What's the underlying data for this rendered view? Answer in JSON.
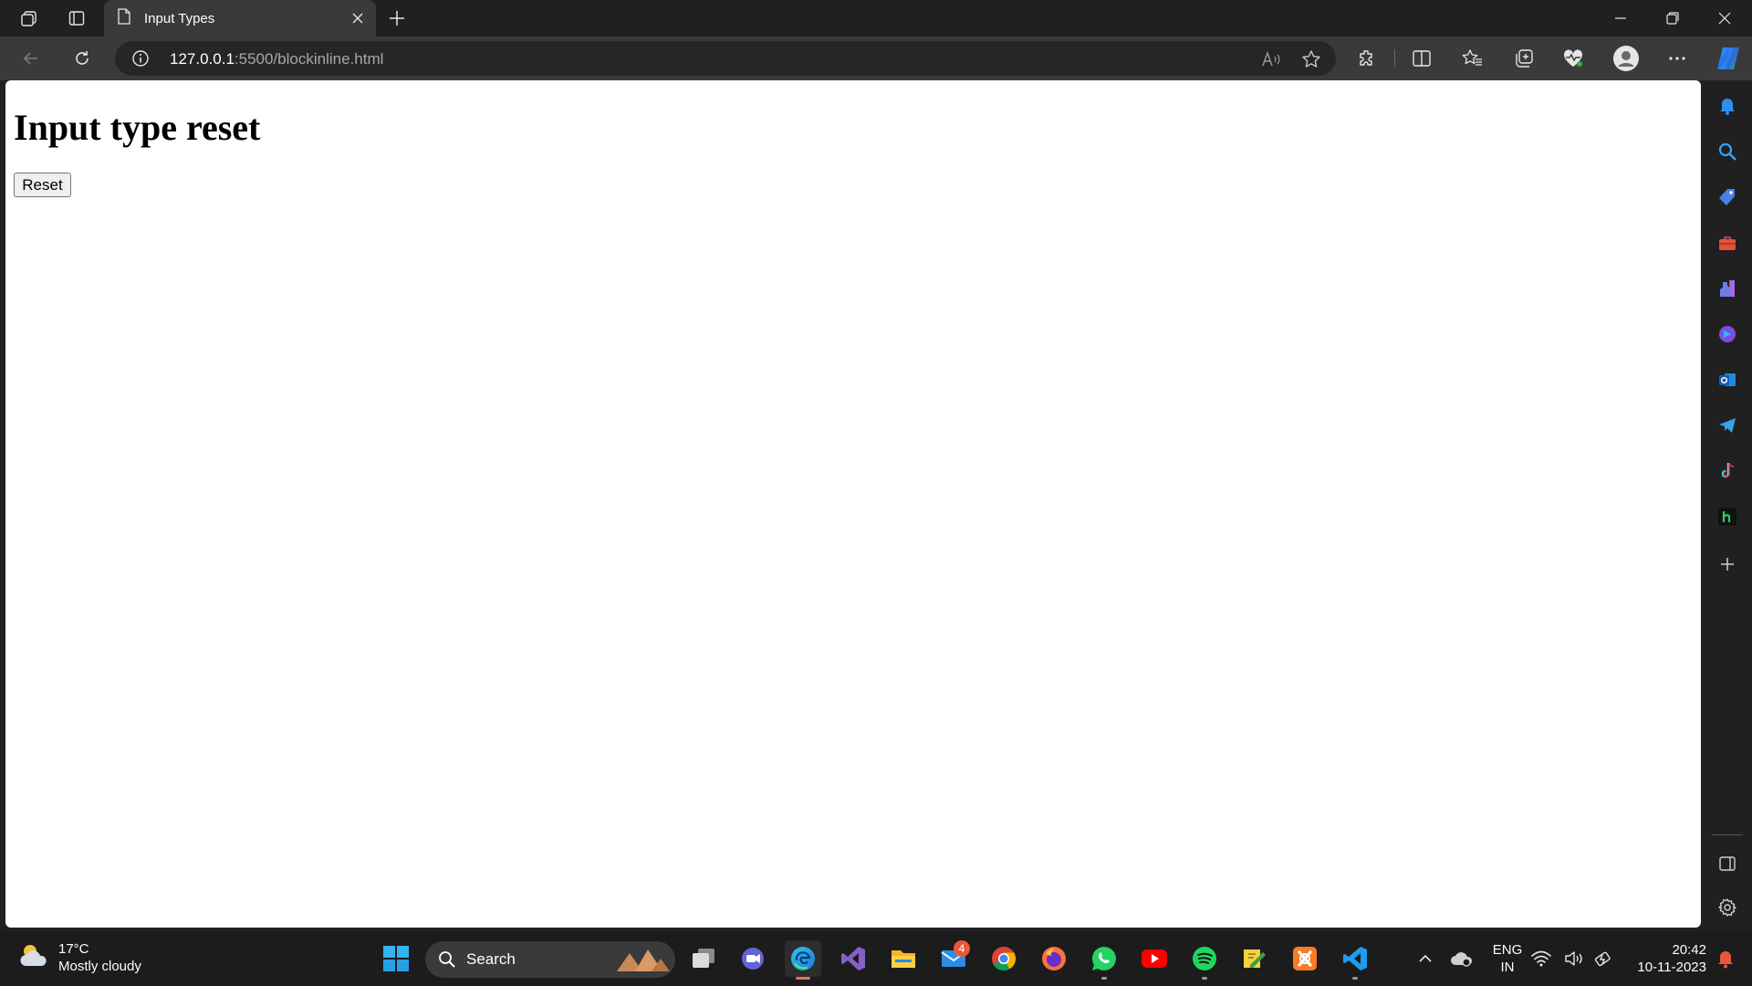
{
  "browser": {
    "tab_title": "Input Types",
    "url_host": "127.0.0.1",
    "url_path": ":5500/blockinline.html"
  },
  "page": {
    "heading": "Input type reset",
    "reset_button_label": "Reset"
  },
  "taskbar": {
    "weather_temp": "17°C",
    "weather_desc": "Mostly cloudy",
    "search_label": "Search",
    "mail_badge": "4",
    "lang_line1": "ENG",
    "lang_line2": "IN",
    "time": "20:42",
    "date": "10-11-2023"
  },
  "colors": {
    "accent_red": "#e8593b",
    "page_bg": "#ffffff",
    "chrome_dark": "#202020"
  }
}
